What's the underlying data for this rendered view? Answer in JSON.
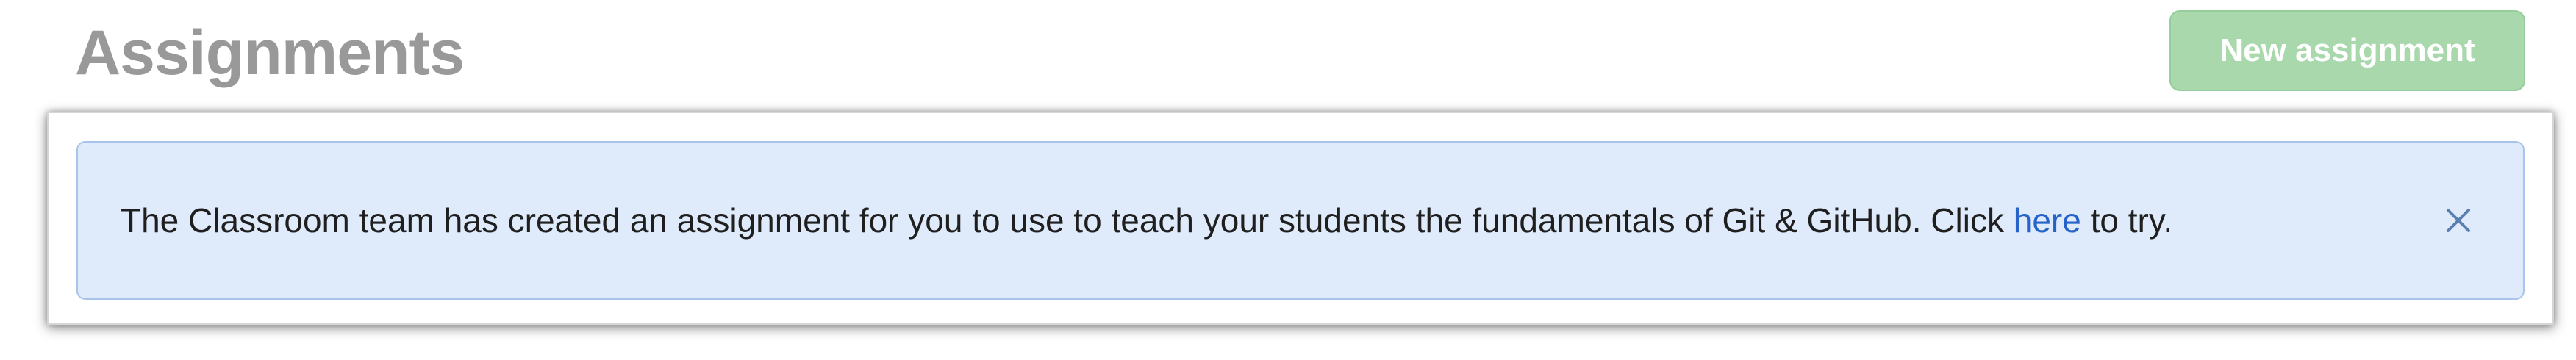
{
  "header": {
    "title": "Assignments",
    "new_assignment_label": "New assignment"
  },
  "flash": {
    "message_before": "The Classroom team has created an assignment for you to use to teach your students the fundamentals of Git & GitHub. Click ",
    "link_text": "here",
    "message_after": " to try.",
    "close_icon": "close-icon"
  },
  "colors": {
    "title": "#999999",
    "new_button_bg": "#a8d8ac",
    "flash_bg": "#dfebfb",
    "flash_border": "#a9c4ea",
    "link": "#2563c9",
    "close_icon": "#5a7fb0"
  }
}
